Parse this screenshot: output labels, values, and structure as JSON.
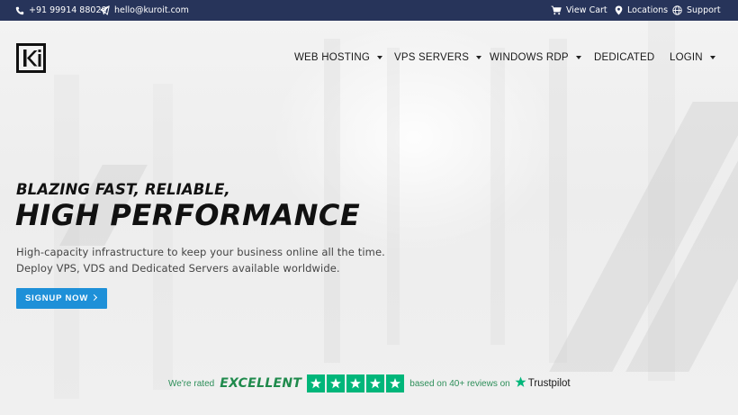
{
  "topbar": {
    "phone": "+91 99914 88020",
    "email": "hello@kuroit.com",
    "cart": "View Cart",
    "locations": "Locations",
    "support": "Support"
  },
  "nav": {
    "items": [
      {
        "label": "WEB HOSTING",
        "dropdown": true
      },
      {
        "label": "VPS SERVERS",
        "dropdown": true
      },
      {
        "label": "WINDOWS RDP",
        "dropdown": true
      },
      {
        "label": "DEDICATED",
        "dropdown": false
      },
      {
        "label": "LOGIN",
        "dropdown": true
      }
    ]
  },
  "hero": {
    "subheading": "BLAZING FAST, RELIABLE,",
    "heading": "HIGH PERFORMANCE",
    "description_line1": "High-capacity infrastructure to keep your business online all the time.",
    "description_line2": "Deploy VPS, VDS and Dedicated Servers available worldwide.",
    "cta_label": "SIGNUP NOW"
  },
  "trustpilot": {
    "rated_text": "We're rated",
    "rating_word": "EXCELLENT",
    "stars": 5,
    "reviews_text": "based on 40+ reviews on",
    "brand": "Trustpilot"
  },
  "colors": {
    "topbar_bg": "#27345a",
    "cta_bg": "#1e90d8",
    "trustpilot_green": "#00b67a"
  }
}
